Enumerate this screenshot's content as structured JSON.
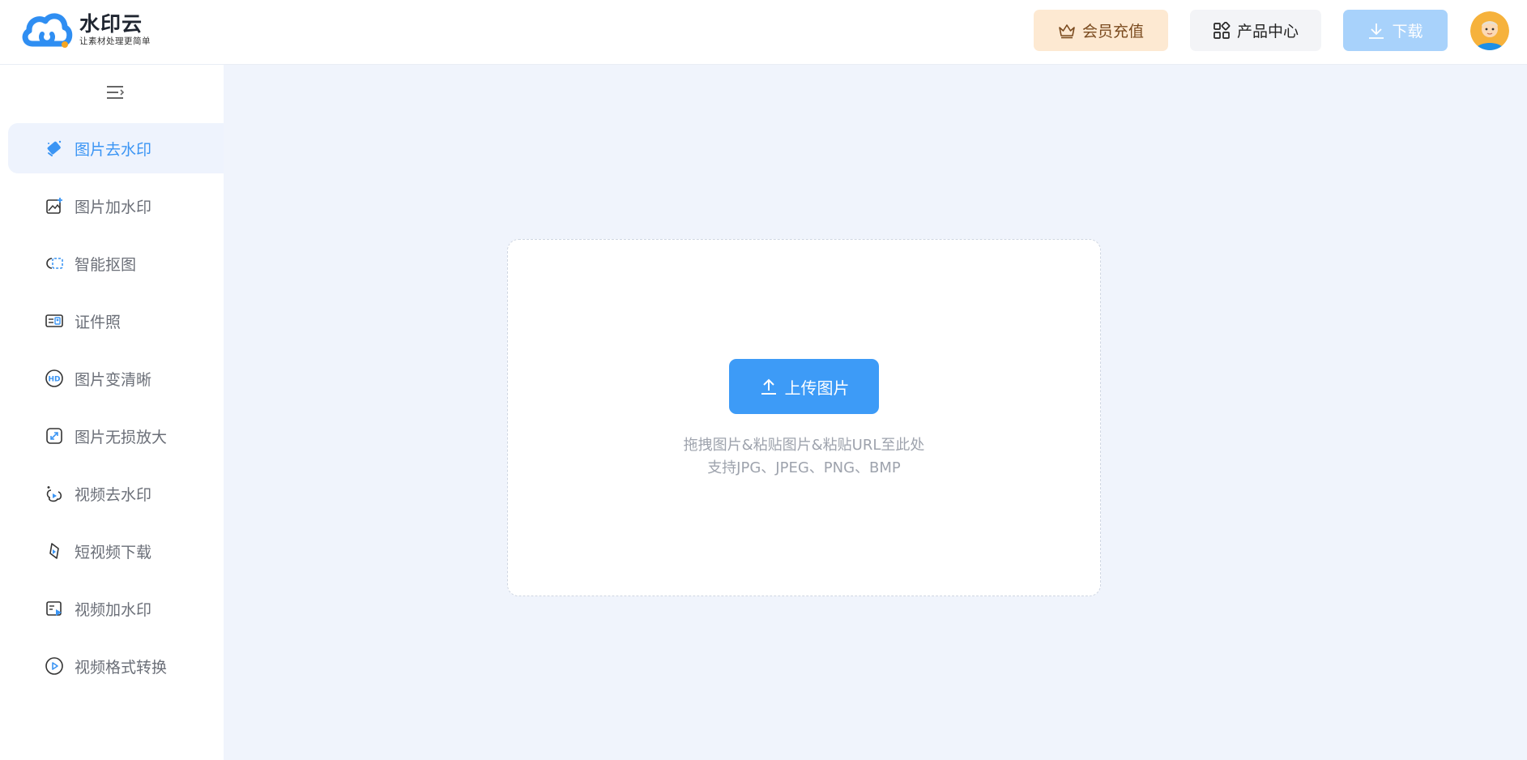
{
  "brand": {
    "name": "水印云",
    "slogan": "让素材处理更简单",
    "colors": {
      "primary": "#3d9bf7",
      "logo_blue": "#2f8ef2",
      "logo_orange": "#f5a623"
    }
  },
  "header": {
    "vip_label": "会员充值",
    "vip_icon": "crown-icon",
    "products_label": "产品中心",
    "products_icon": "apps-grid-icon",
    "download_label": "下载",
    "download_icon": "download-icon",
    "avatar": "user-avatar"
  },
  "sidebar": {
    "collapse_icon": "menu-collapse-icon",
    "items": [
      {
        "label": "图片去水印",
        "icon": "eraser-icon",
        "active": true
      },
      {
        "label": "图片加水印",
        "icon": "image-add-icon",
        "active": false
      },
      {
        "label": "智能抠图",
        "icon": "cutout-icon",
        "active": false
      },
      {
        "label": "证件照",
        "icon": "id-card-icon",
        "active": false
      },
      {
        "label": "图片变清晰",
        "icon": "hd-icon",
        "active": false
      },
      {
        "label": "图片无损放大",
        "icon": "enlarge-icon",
        "active": false
      },
      {
        "label": "视频去水印",
        "icon": "video-erase-icon",
        "active": false
      },
      {
        "label": "短视频下载",
        "icon": "short-video-download-icon",
        "active": false
      },
      {
        "label": "视频加水印",
        "icon": "video-watermark-icon",
        "active": false
      },
      {
        "label": "视频格式转换",
        "icon": "video-convert-icon",
        "active": false
      }
    ]
  },
  "main": {
    "upload_label": "上传图片",
    "upload_icon": "upload-icon",
    "hint_line1": "拖拽图片&粘贴图片&粘贴URL至此处",
    "hint_line2": "支持JPG、JPEG、PNG、BMP"
  }
}
